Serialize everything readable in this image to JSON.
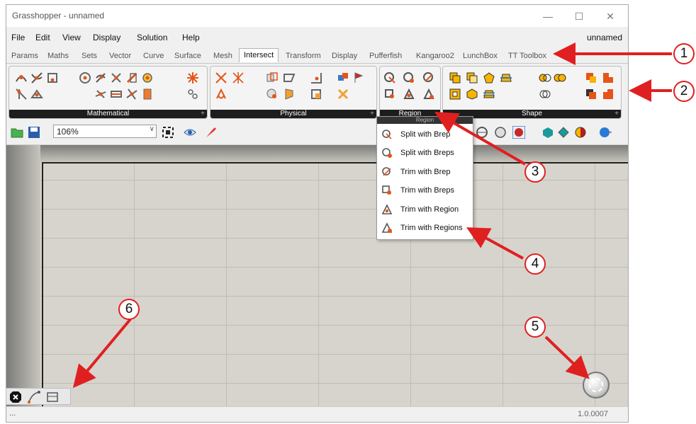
{
  "window": {
    "title": "Grasshopper - unnamed",
    "controls": {
      "minimize": "—",
      "maximize": "☐",
      "close": "✕"
    }
  },
  "menu": {
    "items": [
      "File",
      "Edit",
      "View",
      "Display",
      "Solution",
      "Help"
    ],
    "document_name": "unnamed"
  },
  "tabs": {
    "items": [
      "Params",
      "Maths",
      "Sets",
      "Vector",
      "Curve",
      "Surface",
      "Mesh",
      "Intersect",
      "Transform",
      "Display",
      "Pufferfish",
      "Kangaroo2",
      "LunchBox",
      "TT Toolbox"
    ],
    "active": "Intersect"
  },
  "ribbon": {
    "panels": [
      {
        "label": "Mathematical"
      },
      {
        "label": "Physical"
      },
      {
        "label": "Region"
      },
      {
        "label": "Shape"
      }
    ],
    "expand_glyph": "+"
  },
  "toolbar": {
    "zoom": "106%",
    "zoom_dropdown_glyph": "∨"
  },
  "region_popup": {
    "header": "Region",
    "items": [
      {
        "label": "Split with Brep",
        "icon": "split-brep-icon"
      },
      {
        "label": "Split with Breps",
        "icon": "split-breps-icon"
      },
      {
        "label": "Trim with Brep",
        "icon": "trim-brep-icon"
      },
      {
        "label": "Trim with Breps",
        "icon": "trim-breps-icon"
      },
      {
        "label": "Trim with Region",
        "icon": "trim-region-icon"
      },
      {
        "label": "Trim with Regions",
        "icon": "trim-regions-icon"
      }
    ]
  },
  "statusbar": {
    "left": "...",
    "version": "1.0.0007"
  },
  "callouts": [
    "1",
    "2",
    "3",
    "4",
    "5",
    "6"
  ],
  "colors": {
    "callout_red": "#e02020",
    "canvas_bg": "#d6d4cd",
    "panel_label_bg": "#1d1d1d"
  }
}
